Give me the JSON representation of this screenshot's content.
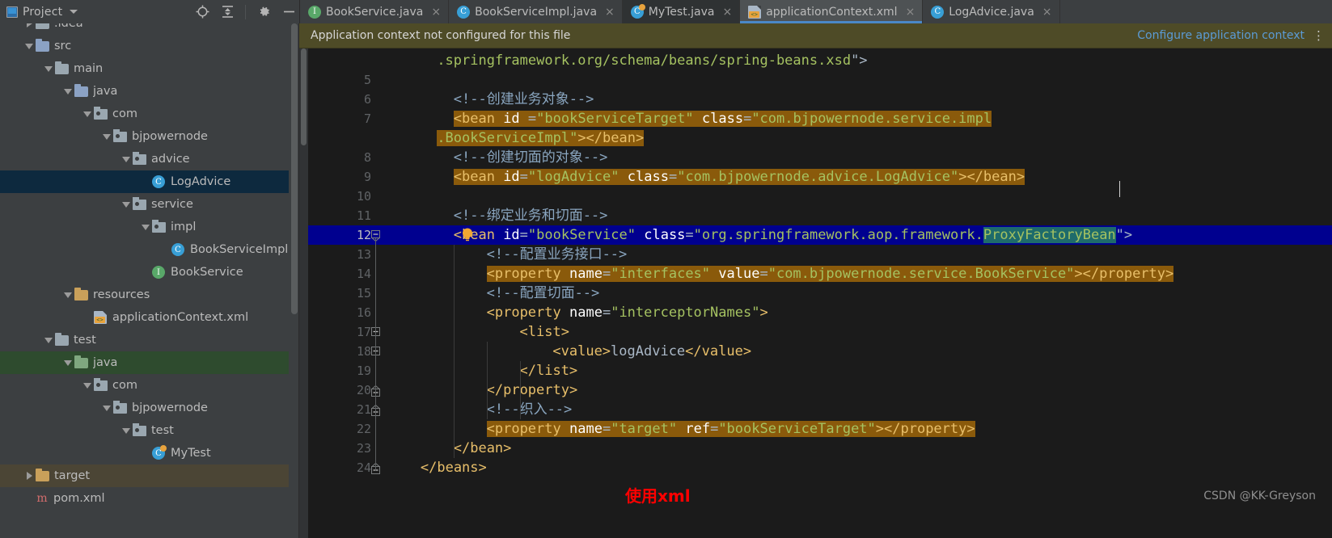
{
  "project_panel": {
    "title": "Project",
    "icons": [
      "locate-icon",
      "collapse-all-icon",
      "settings-gear-icon",
      "hide-icon"
    ],
    "tree": [
      {
        "indent": 1,
        "arrow": "right",
        "icon": "folder",
        "label": ".idea",
        "state": "normal"
      },
      {
        "indent": 1,
        "arrow": "down",
        "icon": "folder-src",
        "label": "src",
        "state": "normal"
      },
      {
        "indent": 2,
        "arrow": "down",
        "icon": "folder",
        "label": "main",
        "state": "normal"
      },
      {
        "indent": 3,
        "arrow": "down",
        "icon": "folder-src",
        "label": "java",
        "state": "normal"
      },
      {
        "indent": 4,
        "arrow": "down",
        "icon": "package",
        "label": "com",
        "state": "normal"
      },
      {
        "indent": 5,
        "arrow": "down",
        "icon": "package",
        "label": "bjpowernode",
        "state": "normal"
      },
      {
        "indent": 6,
        "arrow": "down",
        "icon": "package",
        "label": "advice",
        "state": "normal"
      },
      {
        "indent": 7,
        "arrow": "none",
        "icon": "class",
        "label": "LogAdvice",
        "state": "selected"
      },
      {
        "indent": 6,
        "arrow": "down",
        "icon": "package",
        "label": "service",
        "state": "normal"
      },
      {
        "indent": 7,
        "arrow": "down",
        "icon": "package",
        "label": "impl",
        "state": "normal"
      },
      {
        "indent": 8,
        "arrow": "none",
        "icon": "class",
        "label": "BookServiceImpl",
        "state": "normal"
      },
      {
        "indent": 7,
        "arrow": "none",
        "icon": "interface",
        "label": "BookService",
        "state": "normal"
      },
      {
        "indent": 3,
        "arrow": "down",
        "icon": "folder-res",
        "label": "resources",
        "state": "normal"
      },
      {
        "indent": 4,
        "arrow": "none",
        "icon": "xml",
        "label": "applicationContext.xml",
        "state": "normal"
      },
      {
        "indent": 2,
        "arrow": "down",
        "icon": "folder",
        "label": "test",
        "state": "normal"
      },
      {
        "indent": 3,
        "arrow": "down",
        "icon": "folder-test",
        "label": "java",
        "state": "green"
      },
      {
        "indent": 4,
        "arrow": "down",
        "icon": "package",
        "label": "com",
        "state": "normal"
      },
      {
        "indent": 5,
        "arrow": "down",
        "icon": "package",
        "label": "bjpowernode",
        "state": "normal"
      },
      {
        "indent": 6,
        "arrow": "down",
        "icon": "package",
        "label": "test",
        "state": "normal"
      },
      {
        "indent": 7,
        "arrow": "none",
        "icon": "test-class",
        "label": "MyTest",
        "state": "normal"
      },
      {
        "indent": 1,
        "arrow": "right",
        "icon": "folder-tgt",
        "label": "target",
        "state": "brown"
      },
      {
        "indent": 1,
        "arrow": "none",
        "icon": "maven",
        "label": "pom.xml",
        "state": "normal"
      }
    ]
  },
  "tabs": [
    {
      "label": "BookService.java",
      "icon": "java-interface-icon",
      "active": false,
      "dim": false
    },
    {
      "label": "BookServiceImpl.java",
      "icon": "java-class-icon",
      "active": false,
      "dim": false
    },
    {
      "label": "MyTest.java",
      "icon": "java-test-class-icon",
      "active": false,
      "dim": true
    },
    {
      "label": "applicationContext.xml",
      "icon": "spring-xml-icon",
      "active": true,
      "dim": false
    },
    {
      "label": "LogAdvice.java",
      "icon": "java-class-icon",
      "active": false,
      "dim": false
    }
  ],
  "notification": {
    "message": "Application context not configured for this file",
    "action": "Configure application context",
    "menu": "⋮"
  },
  "editor": {
    "current_line": 12,
    "gutter_bulb": "intention-bulb-icon",
    "lines": [
      {
        "num": "",
        "indent": 6,
        "tokens": [
          {
            "t": ".springframework.org/schema/beans/spring-beans.xsd",
            "c": "t-val"
          },
          {
            "t": "\">",
            "c": "t-punc"
          }
        ]
      },
      {
        "num": "5",
        "indent": 0,
        "tokens": []
      },
      {
        "num": "6",
        "indent": 8,
        "tokens": [
          {
            "t": "<!--创建业务对象-->",
            "c": "t-xcmt"
          }
        ]
      },
      {
        "num": "7",
        "indent": 8,
        "hl": "search",
        "tokens": [
          {
            "t": "<bean",
            "c": "t-tag"
          },
          {
            "t": " ",
            "c": "t-punc"
          },
          {
            "t": "id",
            "c": "t-white"
          },
          {
            "t": " =",
            "c": "t-punc"
          },
          {
            "t": "\"bookServiceTarget\"",
            "c": "t-val"
          },
          {
            "t": " ",
            "c": "t-punc"
          },
          {
            "t": "class",
            "c": "t-white"
          },
          {
            "t": "=",
            "c": "t-punc"
          },
          {
            "t": "\"com.bjpowernode.service.impl",
            "c": "t-val"
          }
        ]
      },
      {
        "num": "",
        "indent": 6,
        "hl": "search",
        "tokens": [
          {
            "t": ".BookServiceImpl\"",
            "c": "t-val"
          },
          {
            "t": "></bean>",
            "c": "t-tag"
          }
        ]
      },
      {
        "num": "8",
        "indent": 8,
        "tokens": [
          {
            "t": "<!--创建切面的对象-->",
            "c": "t-xcmt"
          }
        ]
      },
      {
        "num": "9",
        "indent": 8,
        "hl": "search",
        "tokens": [
          {
            "t": "<bean",
            "c": "t-tag"
          },
          {
            "t": " ",
            "c": "t-punc"
          },
          {
            "t": "id",
            "c": "t-white"
          },
          {
            "t": "=",
            "c": "t-punc"
          },
          {
            "t": "\"logAdvice\"",
            "c": "t-val"
          },
          {
            "t": " ",
            "c": "t-punc"
          },
          {
            "t": "class",
            "c": "t-white"
          },
          {
            "t": "=",
            "c": "t-punc"
          },
          {
            "t": "\"com.bjpowernode.advice.LogAdvice\"",
            "c": "t-val"
          },
          {
            "t": "></bean>",
            "c": "t-tag"
          }
        ]
      },
      {
        "num": "10",
        "indent": 0,
        "tokens": []
      },
      {
        "num": "11",
        "indent": 8,
        "tokens": [
          {
            "t": "<!--绑定业务和切面-->",
            "c": "t-xcmt"
          }
        ]
      },
      {
        "num": "12",
        "indent": 8,
        "selected": true,
        "tokens": [
          {
            "t": "<bean",
            "c": "t-tag"
          },
          {
            "t": " ",
            "c": "t-punc"
          },
          {
            "t": "id",
            "c": "t-white"
          },
          {
            "t": "=",
            "c": "t-punc"
          },
          {
            "t": "\"bookService\"",
            "c": "t-val"
          },
          {
            "t": " ",
            "c": "t-punc"
          },
          {
            "t": "class",
            "c": "t-white"
          },
          {
            "t": "=",
            "c": "t-punc"
          },
          {
            "t": "\"org.springframework.aop.framework.",
            "c": "t-val"
          },
          {
            "t": "ProxyFactoryBean",
            "c": "t-val",
            "bg": "ident"
          },
          {
            "t": "\">",
            "c": "t-punc"
          }
        ]
      },
      {
        "num": "13",
        "indent": 12,
        "tokens": [
          {
            "t": "<!--配置业务接口-->",
            "c": "t-xcmt"
          }
        ]
      },
      {
        "num": "14",
        "indent": 12,
        "hl": "search",
        "tokens": [
          {
            "t": "<property",
            "c": "t-tag"
          },
          {
            "t": " ",
            "c": "t-punc"
          },
          {
            "t": "name",
            "c": "t-white"
          },
          {
            "t": "=",
            "c": "t-punc"
          },
          {
            "t": "\"interfaces\"",
            "c": "t-val"
          },
          {
            "t": " ",
            "c": "t-punc"
          },
          {
            "t": "value",
            "c": "t-white"
          },
          {
            "t": "=",
            "c": "t-punc"
          },
          {
            "t": "\"com.bjpowernode.service.BookService\"",
            "c": "t-val"
          },
          {
            "t": "></property>",
            "c": "t-tag"
          }
        ]
      },
      {
        "num": "15",
        "indent": 12,
        "tokens": [
          {
            "t": "<!--配置切面-->",
            "c": "t-xcmt"
          }
        ]
      },
      {
        "num": "16",
        "indent": 12,
        "tokens": [
          {
            "t": "<property",
            "c": "t-tag"
          },
          {
            "t": " ",
            "c": "t-punc"
          },
          {
            "t": "name",
            "c": "t-white"
          },
          {
            "t": "=",
            "c": "t-punc"
          },
          {
            "t": "\"interceptorNames\"",
            "c": "t-val"
          },
          {
            "t": ">",
            "c": "t-tag"
          }
        ]
      },
      {
        "num": "17",
        "indent": 16,
        "tokens": [
          {
            "t": "<list>",
            "c": "t-tag"
          }
        ]
      },
      {
        "num": "18",
        "indent": 20,
        "tokens": [
          {
            "t": "<value>",
            "c": "t-tag"
          },
          {
            "t": "logAdvice",
            "c": "t-text"
          },
          {
            "t": "</value>",
            "c": "t-tag"
          }
        ]
      },
      {
        "num": "19",
        "indent": 16,
        "tokens": [
          {
            "t": "</list>",
            "c": "t-tag"
          }
        ]
      },
      {
        "num": "20",
        "indent": 12,
        "tokens": [
          {
            "t": "</property>",
            "c": "t-tag"
          }
        ]
      },
      {
        "num": "21",
        "indent": 12,
        "tokens": [
          {
            "t": "<!--织入-->",
            "c": "t-xcmt"
          }
        ]
      },
      {
        "num": "22",
        "indent": 12,
        "hl": "search",
        "tokens": [
          {
            "t": "<property",
            "c": "t-tag"
          },
          {
            "t": " ",
            "c": "t-punc"
          },
          {
            "t": "name",
            "c": "t-white"
          },
          {
            "t": "=",
            "c": "t-punc"
          },
          {
            "t": "\"target\"",
            "c": "t-val"
          },
          {
            "t": " ",
            "c": "t-punc"
          },
          {
            "t": "ref",
            "c": "t-white"
          },
          {
            "t": "=",
            "c": "t-punc"
          },
          {
            "t": "\"bookServiceTarget\"",
            "c": "t-val"
          },
          {
            "t": "></property>",
            "c": "t-tag"
          }
        ]
      },
      {
        "num": "23",
        "indent": 8,
        "tokens": [
          {
            "t": "</bean>",
            "c": "t-tag"
          }
        ]
      },
      {
        "num": "24",
        "indent": 4,
        "tokens": [
          {
            "t": "</beans>",
            "c": "t-tag"
          }
        ]
      }
    ],
    "folds": [
      {
        "line_index": 9,
        "type": "minus-expanded"
      },
      {
        "line_index": 14,
        "type": "minus-expanded"
      },
      {
        "line_index": 15,
        "type": "minus-expanded"
      },
      {
        "line_index": 17,
        "type": "minus-collapsed"
      },
      {
        "line_index": 18,
        "type": "minus-collapsed"
      },
      {
        "line_index": 21,
        "type": "minus-collapsed"
      }
    ]
  },
  "watermarks": {
    "red_note": "使用xml",
    "csdn": "CSDN @KK-Greyson"
  },
  "colors": {
    "panel_bg": "#3c3f41",
    "editor_bg": "#1b1b1b",
    "tab_active_bg": "#4e5254",
    "tab_underline": "#4a88c7",
    "notification_bg": "#4e4b27",
    "link": "#5b9bd5",
    "selection_line": "#00008f",
    "search_highlight": "#8a5a0b",
    "identifier_highlight": "#1e6b6b",
    "tree_selected": "#0d293e",
    "red_note": "#fe0000"
  }
}
